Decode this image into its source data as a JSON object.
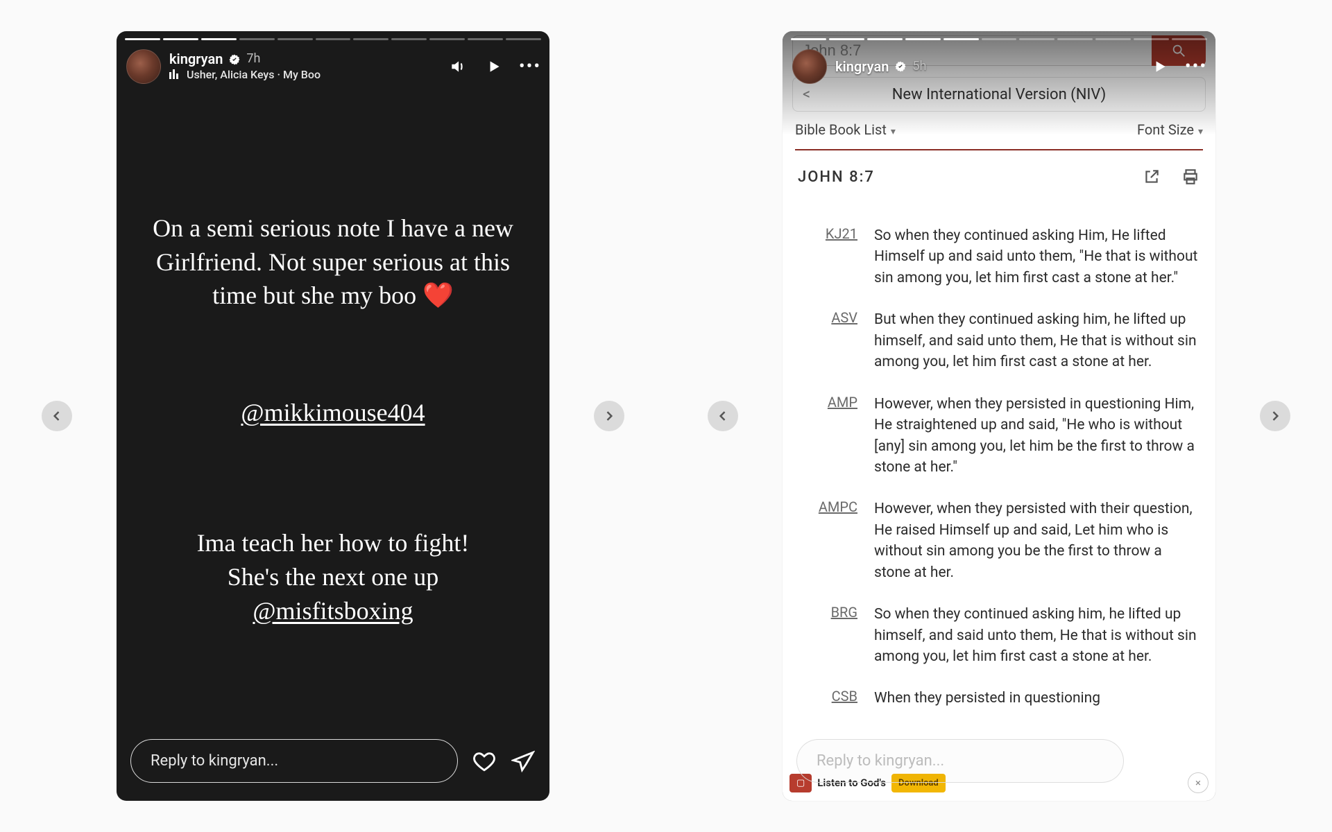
{
  "left": {
    "username": "kingryan",
    "time": "7h",
    "music": "Usher, Alicia Keys · My Boo",
    "progress_total": 11,
    "progress_done": 3,
    "body": {
      "p1": "On a semi serious note I have a new Girlfriend. Not super serious at this time but she my boo ",
      "heart": "❤️",
      "mention": "@mikkimouse404",
      "p2a": "Ima teach her how to fight!",
      "p2b": "She's the next one up",
      "mention2": "@misfitsboxing"
    },
    "reply_placeholder": "Reply to kingryan..."
  },
  "right": {
    "username": "kingryan",
    "time": "5h",
    "progress_total": 11,
    "progress_done": 5,
    "search_value": "John 8:7",
    "version_name": "New International Version (NIV)",
    "booklist_label": "Bible Book List",
    "fontsize_label": "Font Size",
    "reference": "JOHN  8:7",
    "reply_placeholder": "Reply to kingryan...",
    "banner_mid": "Listen to God's",
    "banner_btn2": "Download",
    "banner_close": "×",
    "verses": [
      {
        "code": "KJ21",
        "text": "So when they continued asking Him, He lifted Himself up and said unto them, \"He that is without sin among you, let him first cast a stone at her.\""
      },
      {
        "code": "ASV",
        "text": "But when they continued asking him, he lifted up himself, and said unto them, He that is without sin among you, let him first cast a stone at her."
      },
      {
        "code": "AMP",
        "text": "However, when they persisted in questioning Him, He straightened up and said, \"He who is without [any] sin among you, let him be the first to throw a stone at her.\""
      },
      {
        "code": "AMPC",
        "text": "However, when they persisted with their question, He raised Himself up and said, Let him who is without sin among you be the first to throw a stone at her."
      },
      {
        "code": "BRG",
        "text": "So when they continued asking him, he lifted up himself, and said unto them, He that is without sin among you, let him first cast a stone at her."
      },
      {
        "code": "CSB",
        "text": "When they persisted in questioning"
      }
    ]
  }
}
